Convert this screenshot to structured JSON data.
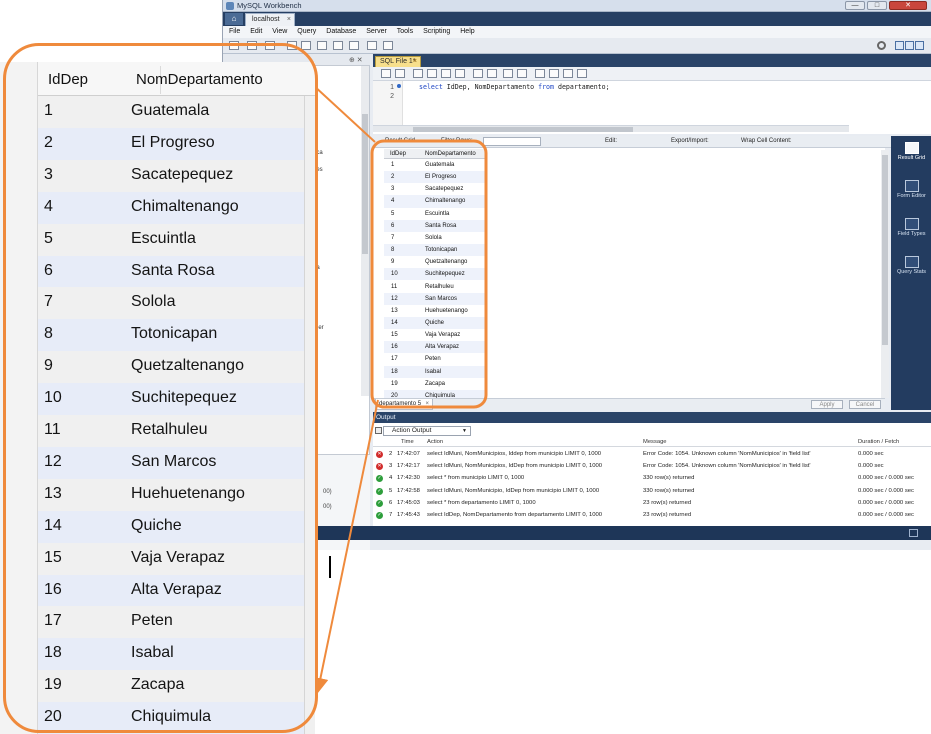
{
  "window": {
    "title": "MySQL Workbench",
    "min_label": "—",
    "max_label": "□",
    "close_label": "✕",
    "home_label": "⌂",
    "connection_tab": "localhost",
    "connection_tab_close": "×"
  },
  "menu": [
    "File",
    "Edit",
    "View",
    "Query",
    "Database",
    "Server",
    "Tools",
    "Scripting",
    "Help"
  ],
  "editor": {
    "tab_label": "SQL File 1*",
    "tab_close": "×",
    "line_numbers": [
      "1",
      "2"
    ],
    "sql_keyword_select": "select",
    "sql_cols": " IdDep, NomDepartamento ",
    "sql_keyword_from": "from",
    "sql_table": " departamento;"
  },
  "result_toolbar": {
    "result_grid": "Result Grid",
    "filter_rows": "Filter Rows:",
    "edit": "Edit:",
    "export_import": "Export/Import:",
    "wrap_cell": "Wrap Cell Content:"
  },
  "side_panel": [
    "Result Grid",
    "Form Editor",
    "Field Types",
    "Query Stats"
  ],
  "navigator_fragments": {
    "top": [
      "ica",
      "les",
      "ia",
      "",
      "der"
    ],
    "bottom": [
      "00)",
      "00)"
    ]
  },
  "result_grid": {
    "columns": [
      "IdDep",
      "NomDepartamento"
    ],
    "rows": [
      [
        "1",
        "Guatemala"
      ],
      [
        "2",
        "El Progreso"
      ],
      [
        "3",
        "Sacatepequez"
      ],
      [
        "4",
        "Chimaltenango"
      ],
      [
        "5",
        "Escuintla"
      ],
      [
        "6",
        "Santa Rosa"
      ],
      [
        "7",
        "Solola"
      ],
      [
        "8",
        "Totonicapan"
      ],
      [
        "9",
        "Quetzaltenango"
      ],
      [
        "10",
        "Suchitepequez"
      ],
      [
        "11",
        "Retalhuleu"
      ],
      [
        "12",
        "San Marcos"
      ],
      [
        "13",
        "Huehuetenango"
      ],
      [
        "14",
        "Quiche"
      ],
      [
        "15",
        "Vaja Verapaz"
      ],
      [
        "16",
        "Alta Verapaz"
      ],
      [
        "17",
        "Peten"
      ],
      [
        "18",
        "Isabal"
      ],
      [
        "19",
        "Zacapa"
      ],
      [
        "20",
        "Chiquimula"
      ]
    ]
  },
  "result_tab": {
    "label": "departamento 5",
    "close": "×",
    "apply": "Apply",
    "cancel": "Cancel"
  },
  "output": {
    "title": "Output",
    "selector": "Action Output",
    "selector_arrow": "▼",
    "columns": [
      "Time",
      "Action",
      "Message",
      "Duration / Fetch"
    ],
    "rows": [
      {
        "status": "error",
        "num": "2",
        "time": "17:42:07",
        "action": "select IdMuni, NomMunicipios, Iddep from municipio LIMIT 0, 1000",
        "message": "Error Code: 1054. Unknown column 'NomMunicipios' in 'field list'",
        "duration": "0.000 sec"
      },
      {
        "status": "error",
        "num": "3",
        "time": "17:42:17",
        "action": "select IdMuni, NomMunicipios, IdDep from municipio LIMIT 0, 1000",
        "message": "Error Code: 1054. Unknown column 'NomMunicipios' in 'field list'",
        "duration": "0.000 sec"
      },
      {
        "status": "ok",
        "num": "4",
        "time": "17:42:30",
        "action": "select * from municipio LIMIT 0, 1000",
        "message": "330 row(s) returned",
        "duration": "0.000 sec / 0.000 sec"
      },
      {
        "status": "ok",
        "num": "5",
        "time": "17:42:58",
        "action": "select IdMuni, NomMunicipio, IdDep from municipio LIMIT 0, 1000",
        "message": "330 row(s) returned",
        "duration": "0.000 sec / 0.000 sec"
      },
      {
        "status": "ok",
        "num": "6",
        "time": "17:45:03",
        "action": "select * from departamento LIMIT 0, 1000",
        "message": "23 row(s) returned",
        "duration": "0.000 sec / 0.000 sec"
      },
      {
        "status": "ok",
        "num": "7",
        "time": "17:45:43",
        "action": "select IdDep, NomDepartamento from departamento LIMIT 0, 1000",
        "message": "23 row(s) returned",
        "duration": "0.000 sec / 0.000 sec"
      }
    ]
  },
  "status_icons": {
    "error": "✕",
    "ok": "✓"
  },
  "colors": {
    "callout_orange": "#ef8a3c",
    "workbench_navy": "#263f63",
    "row_alt_blue": "#e7ecf8",
    "sql_tab_yellow": "#f7df8c",
    "error_red": "#d12b2b",
    "ok_green": "#2e9e3c"
  },
  "icons": [
    "home-icon",
    "gear-icon",
    "result-grid-icon",
    "form-editor-icon",
    "field-types-icon",
    "query-stats-icon",
    "error-status-icon",
    "ok-status-icon"
  ]
}
